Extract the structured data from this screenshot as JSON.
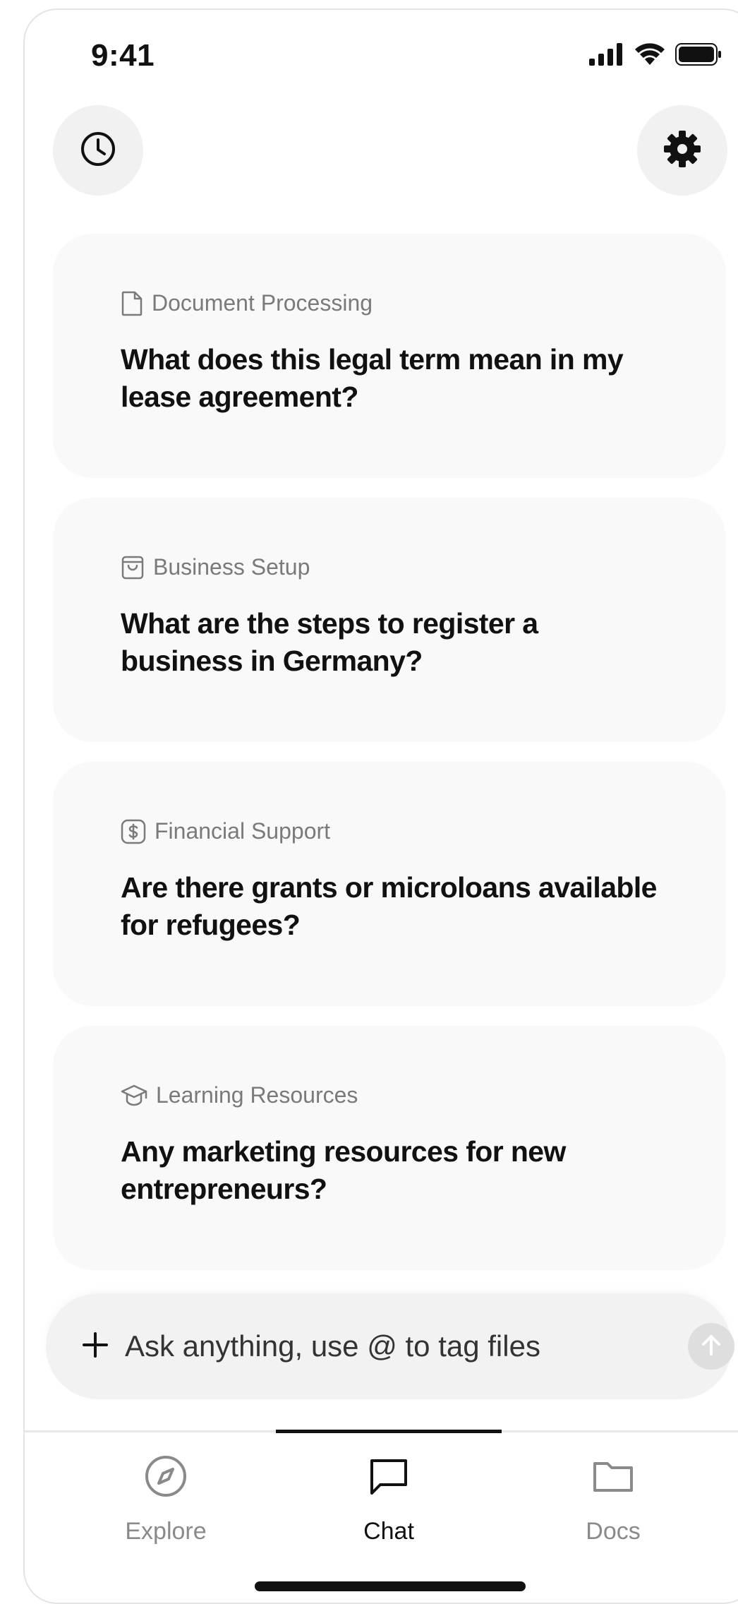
{
  "status_bar": {
    "time": "9:41",
    "icons": [
      "cellular-signal-icon",
      "wifi-icon",
      "battery-icon"
    ]
  },
  "header": {
    "left_button_icon": "clock-icon",
    "right_button_icon": "gear-icon"
  },
  "suggestions": [
    {
      "category": "Document Processing",
      "icon": "document-icon",
      "question": "What does this legal term mean in my lease agreement?"
    },
    {
      "category": "Business Setup",
      "icon": "shopping-bag-icon",
      "question": "What are the steps to register a business in Germany?"
    },
    {
      "category": "Financial Support",
      "icon": "dollar-icon",
      "question": "Are there grants or microloans available for refugees?"
    },
    {
      "category": "Learning Resources",
      "icon": "graduation-cap-icon",
      "question": "Any marketing resources for new entrepreneurs?"
    }
  ],
  "composer": {
    "placeholder": "Ask anything, use @ to tag files",
    "value": ""
  },
  "tabs": [
    {
      "label": "Explore",
      "icon": "compass-icon",
      "active": false
    },
    {
      "label": "Chat",
      "icon": "chat-bubble-icon",
      "active": true
    },
    {
      "label": "Docs",
      "icon": "folder-icon",
      "active": false
    }
  ],
  "colors": {
    "card_background": "#f9f9f9",
    "muted_text": "#7a7a7a",
    "active_tab": "#111111",
    "inactive_tab": "#8a8a8a"
  }
}
